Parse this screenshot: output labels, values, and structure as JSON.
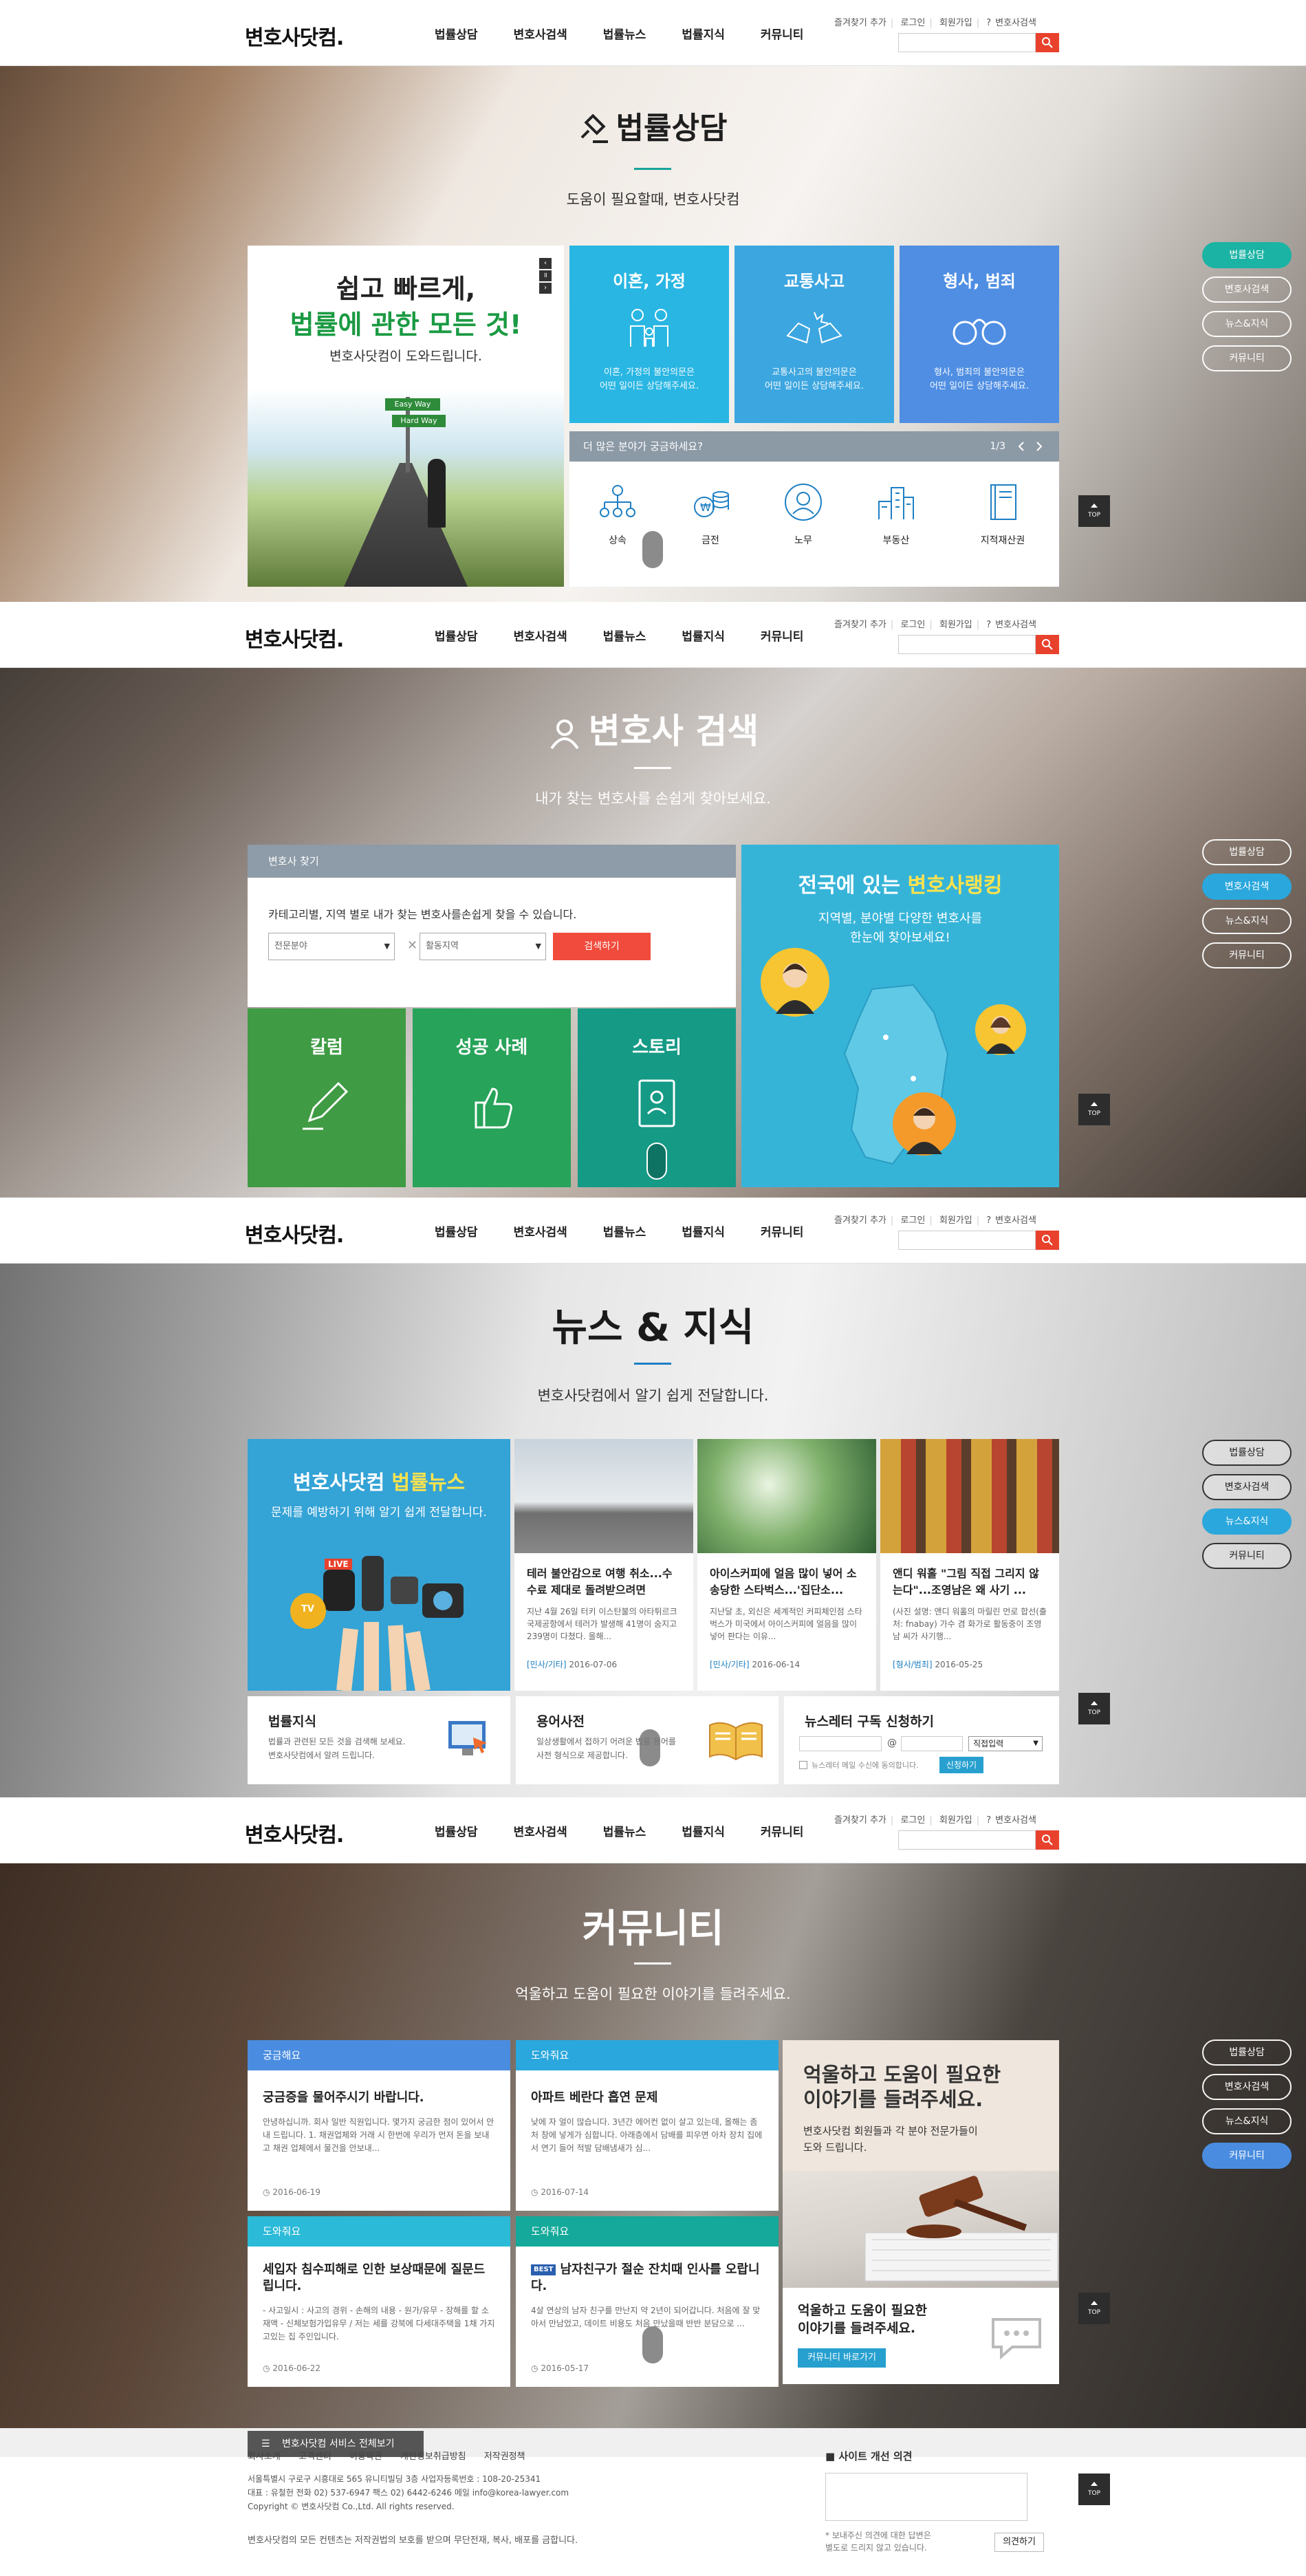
{
  "header": {
    "logo": "변호사닷컴.",
    "nav": [
      "법률상담",
      "변호사검색",
      "법률뉴스",
      "법률지식",
      "커뮤니티"
    ],
    "util": [
      "즐겨찾기 추가",
      "로그인",
      "회원가입",
      "변호사검색"
    ]
  },
  "quicknav": [
    "법률상담",
    "변호사검색",
    "뉴스&지식",
    "커뮤니티"
  ],
  "top_label": "TOP",
  "sec1": {
    "title": "법률상담",
    "subtitle": "도움이 필요할때, 변호사닷컴",
    "hero": {
      "line1": "쉽고 빠르게,",
      "line2": "법률에 관한 모든 것!",
      "line3": "변호사닷컴이 도와드립니다.",
      "sign1": "Easy Way",
      "sign2": "Hard Way"
    },
    "tiles": [
      {
        "title": "이혼, 가정",
        "desc1": "이혼, 가정의 불안의문은",
        "desc2": "어떤 일이든 상담해주세요.",
        "color": "#29b6e3"
      },
      {
        "title": "교통사고",
        "desc1": "교통사고의 불안의문은",
        "desc2": "어떤 일이든 상담해주세요.",
        "color": "#3ca6e0"
      },
      {
        "title": "형사, 범죄",
        "desc1": "형사, 범죄의 불안의문은",
        "desc2": "어떤 일이든 상담해주세요.",
        "color": "#4f8ee3"
      }
    ],
    "more": {
      "label": "더 많은 분야가 궁금하세요?",
      "page": "1/3",
      "categories": [
        "상속",
        "금전",
        "노무",
        "부동산",
        "지적재산권"
      ]
    }
  },
  "sec2": {
    "title": "변호사 검색",
    "subtitle": "내가 찾는 변호사를 손쉽게 찾아보세요.",
    "find": {
      "bar": "변호사 찾기",
      "desc": "카테고리별, 지역 별로 내가 찾는 변호사를손쉽게 찾을 수 있습니다.",
      "select1": "전문분야",
      "select2": "활동지역",
      "button": "검색하기"
    },
    "tiles": [
      {
        "title": "칼럼",
        "color": "#3f9b44"
      },
      {
        "title": "성공 사례",
        "color": "#27a35a"
      },
      {
        "title": "스토리",
        "color": "#159a86"
      }
    ],
    "ranking": {
      "title_a": "전국에 있는",
      "title_b": "변호사랭킹",
      "desc1": "지역별, 분야별 다양한 변호사를",
      "desc2": "한눈에 찾아보세요!"
    }
  },
  "sec3": {
    "title": "뉴스 & 지식",
    "subtitle": "변호사닷컴에서 알기 쉽게 전달합니다.",
    "big": {
      "title_a": "변호사닷컴",
      "title_b": "법률뉴스",
      "desc": "문제를 예방하기 위해 알기 쉽게 전달합니다.",
      "mic": "LIVE",
      "tv": "TV"
    },
    "news": [
      {
        "title": "테러 불안감으로 여행 취소...수수료 제대로 돌려받으려면",
        "desc": "지난 4월 26일 터키 이스탄불의 아타튀르크 국제공항에서 테러가 발생해 41명이 숨지고 239명이 다쳤다. 올해...",
        "cat": "[민사/기타]",
        "date": "2016-07-06"
      },
      {
        "title": "아이스커피에 얼음 많이 넣어 소송당한 스타벅스...'집단소...",
        "desc": "지난달 초, 외신은 세계적인 커피체인점 스타벅스가 미국에서 아이스커피에 얼음을 많이 넣어 판다는 이유...",
        "cat": "[민사/기타]",
        "date": "2016-06-14"
      },
      {
        "title": "앤디 워홀 \"그림 직접 그리지 않는다\"...조영남은 왜 사기 ...",
        "desc": "(사진 설명: 앤디 워홀의 마릴린 먼로 합선(출처: fnabay) 가수 겸 화가로 활동중이 조영남 씨가 사기행...",
        "cat": "[형사/범죄]",
        "date": "2016-05-25"
      }
    ],
    "knowledge": {
      "title": "법률지식",
      "desc1": "법률과 관련된 모든 것을 검색해 보세요.",
      "desc2": "변호사닷컴에서 알려 드립니다."
    },
    "dictionary": {
      "title": "용어사전",
      "desc1": "일상생활에서 접하기 어려운 법률 용어를",
      "desc2": "사전 형식으로 제공합니다."
    },
    "newsletter": {
      "title": "뉴스레터 구독 신청하기",
      "at": "@",
      "select": "직접입력",
      "agree": "뉴스레터 메일 수신에 동의합니다.",
      "button": "신청하기"
    }
  },
  "sec4": {
    "title": "커뮤니티",
    "subtitle": "억울하고 도움이 필요한 이야기를 들려주세요.",
    "cards": [
      {
        "bar": "궁금해요",
        "title": "궁금증을 물어주시기 바랍니다.",
        "desc": "안녕하십니까. 회사 일반 직원입니다. 몇가지 궁금한 점이 있어서 안내 드립니다. 1. 채권업체와 거래 시 한번에 우리가 먼저 돈을 보내고 채권 업체에서 물건을 안보내...",
        "date": "2016-06-19",
        "color": "#4a8de0"
      },
      {
        "bar": "도와줘요",
        "title": "아파트 베란다 흡연 문제",
        "desc": "낮에 자 얼이 많습니다. 3년간 에어컨 없이 살고 있는데, 올해는 좀처 창에 넣게가 심합니다. 아래층에서 담배를 피우면 아차 장치 집에서 연기 들어 적발 담배냄새가 심...",
        "date": "2016-07-14",
        "color": "#2aa7dc"
      },
      {
        "bar": "도와줘요",
        "title": "세입자 침수피해로 인한 보상때문에 질문드립니다.",
        "desc": "- 사고일시 : 사고의 경위 - 손해의 내용 - 원가/유무 - 장해를 할 소재액 - 신체보험가입유무 / 저는 세를 강북에 다세대주택을 1채 가지고있는 집 주인입니다.",
        "date": "2016-06-22",
        "color": "#2bbad8"
      },
      {
        "bar": "도와줘요",
        "badge": "BEST",
        "title": "남자친구가 절순 잔치때 인사를 오랍니다.",
        "desc": "4살 연상의 남자 친구를 만난지 약 2년이 되어갑니다. 처음에 잘 맞아서 만남었고, 데이트 비용도 처음 만났을때 반반 분담으로 ...",
        "date": "2016-05-17",
        "color": "#14a99a"
      }
    ],
    "promo": {
      "title1": "억울하고 도움이 필요한",
      "title2": "이야기를 들려주세요.",
      "desc1": "변호사닷컴 회원들과 각 분야 전문가들이",
      "desc2": "도와 드립니다.",
      "low1": "억울하고 도움이 필요한",
      "low2": "이야기를 들려주세요.",
      "button": "커뮤니티 바로가기"
    }
  },
  "footer": {
    "button": "변호사닷컴 서비스 전체보기",
    "links": [
      "회사소개",
      "고객센터",
      "이용약관",
      "개인정보취급방침",
      "저작권정책"
    ],
    "info1": "서울특별시 구로구 시흥대로 565 유니티빌딩 3층 사업자등록번호 : 108-20-25341",
    "info2": "대표 : 유철헌 전화 02) 537-6947 팩스 02) 6442-6246 메일 info@korea-lawyer.com",
    "info3": "Copyright © 변호사닷컴 Co.,Ltd. All rights reserved.",
    "notice": "변호사닷컴의 모든 컨텐츠는 저작권법의 보호를 받으며 무단전재, 복사, 배포를 금합니다.",
    "suggest": {
      "title": "사이트 개선 의견",
      "note1": "* 보내주신 의견에 대한 답변은",
      "note2": "별도로 드리지 않고 있습니다.",
      "button": "의견하기"
    }
  }
}
